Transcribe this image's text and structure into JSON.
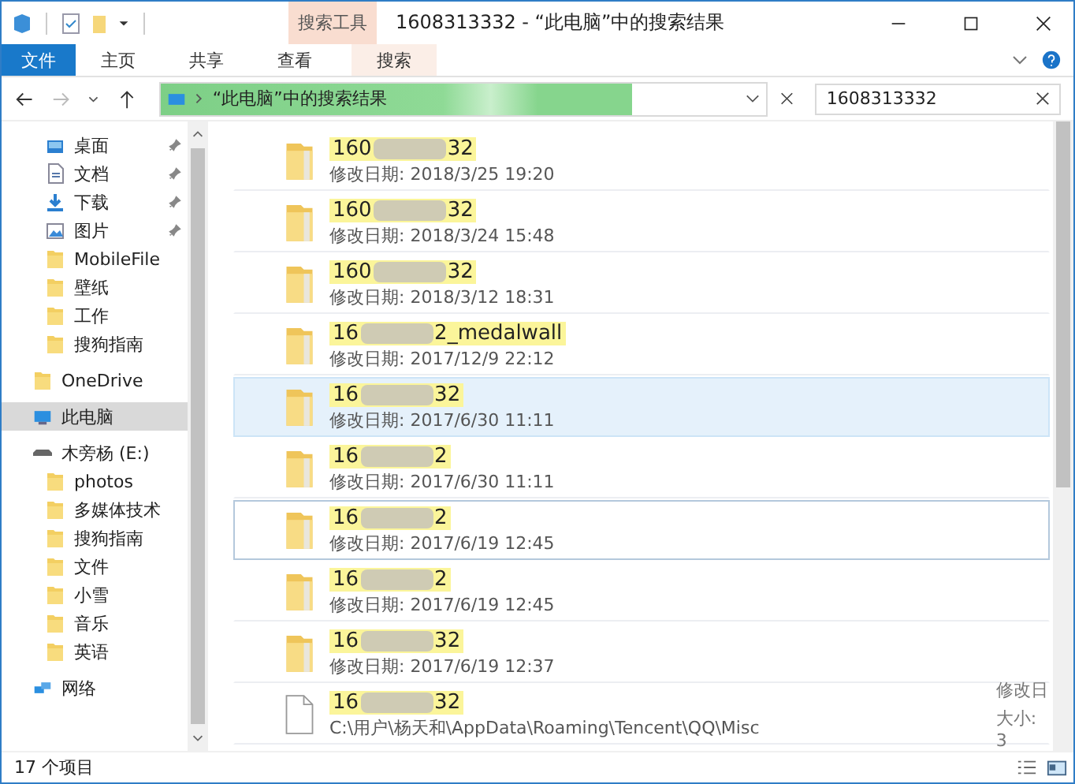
{
  "window": {
    "title": "1608313332 - “此电脑”中的搜索结果",
    "context_tab_group": "搜索工具"
  },
  "ribbon_tabs": [
    {
      "label": "文件",
      "kind": "file"
    },
    {
      "label": "主页",
      "kind": "tab"
    },
    {
      "label": "共享",
      "kind": "tab"
    },
    {
      "label": "查看",
      "kind": "tab"
    },
    {
      "label": "搜索",
      "kind": "context"
    }
  ],
  "address_bar": {
    "path": "“此电脑”中的搜索结果",
    "level": 0.78
  },
  "search": {
    "value": "1608313332"
  },
  "sidebar": {
    "quick_access_items": [
      {
        "label": "桌面",
        "kind": "desktop",
        "pinned": true
      },
      {
        "label": "文档",
        "kind": "document",
        "pinned": true
      },
      {
        "label": "下载",
        "kind": "download",
        "pinned": true
      },
      {
        "label": "图片",
        "kind": "pictures",
        "pinned": true
      },
      {
        "label": "MobileFile",
        "kind": "folder",
        "pinned": false
      },
      {
        "label": "壁纸",
        "kind": "folder",
        "pinned": false
      },
      {
        "label": "工作",
        "kind": "folder",
        "pinned": false
      },
      {
        "label": "搜狗指南",
        "kind": "folder",
        "pinned": false
      }
    ],
    "items": [
      {
        "label": "OneDrive",
        "kind": "folder",
        "selected": false
      },
      {
        "label": "此电脑",
        "kind": "pc",
        "selected": true
      },
      {
        "label": "木旁杨 (E:)",
        "kind": "drive",
        "selected": false,
        "children": [
          {
            "label": "photos",
            "kind": "folder",
            "selected": false
          },
          {
            "label": "多媒体技术",
            "kind": "folder",
            "selected": false
          },
          {
            "label": "搜狗指南",
            "kind": "folder",
            "selected": false
          },
          {
            "label": "文件",
            "kind": "folder",
            "selected": false
          },
          {
            "label": "小雪",
            "kind": "folder",
            "selected": false
          },
          {
            "label": "音乐",
            "kind": "folder",
            "selected": false
          },
          {
            "label": "英语",
            "kind": "folder",
            "selected": false
          }
        ]
      },
      {
        "label": "网络",
        "kind": "network",
        "selected": false
      }
    ]
  },
  "results": [
    {
      "kind": "folder",
      "name_start": "160",
      "name_end": "32",
      "detail": "修改日期: 2018/3/25 19:20",
      "selected": false,
      "focused": false
    },
    {
      "kind": "folder",
      "name_start": "160",
      "name_end": "32",
      "detail": "修改日期: 2018/3/24 15:48",
      "selected": false,
      "focused": false
    },
    {
      "kind": "folder",
      "name_start": "160",
      "name_end": "32",
      "detail": "修改日期: 2018/3/12 18:31",
      "selected": false,
      "focused": false
    },
    {
      "kind": "folder",
      "name_start": "16",
      "name_end": "2_medalwall",
      "detail": "修改日期: 2017/12/9 22:12",
      "selected": false,
      "focused": false
    },
    {
      "kind": "folder",
      "name_start": "16",
      "name_end": "32",
      "detail": "修改日期: 2017/6/30 11:11",
      "selected": true,
      "focused": false
    },
    {
      "kind": "folder",
      "name_start": "16",
      "name_end": "2",
      "detail": "修改日期: 2017/6/30 11:11",
      "selected": false,
      "focused": false
    },
    {
      "kind": "folder",
      "name_start": "16",
      "name_end": "2",
      "detail": "修改日期: 2017/6/19 12:45",
      "selected": false,
      "focused": true
    },
    {
      "kind": "folder",
      "name_start": "16",
      "name_end": "2",
      "detail": "修改日期: 2017/6/19 12:45",
      "selected": false,
      "focused": false
    },
    {
      "kind": "folder",
      "name_start": "16",
      "name_end": "32",
      "detail": "修改日期: 2017/6/19 12:37",
      "selected": false,
      "focused": false
    },
    {
      "kind": "file",
      "name_start": "16",
      "name_end": "32",
      "detail": "C:\\用户\\杨天和\\AppData\\Roaming\\Tencent\\QQ\\Misc",
      "side_1": "修改日",
      "side_2": "大小: 3",
      "selected": false,
      "focused": false
    }
  ],
  "status_bar": {
    "count": "17 个项目"
  }
}
